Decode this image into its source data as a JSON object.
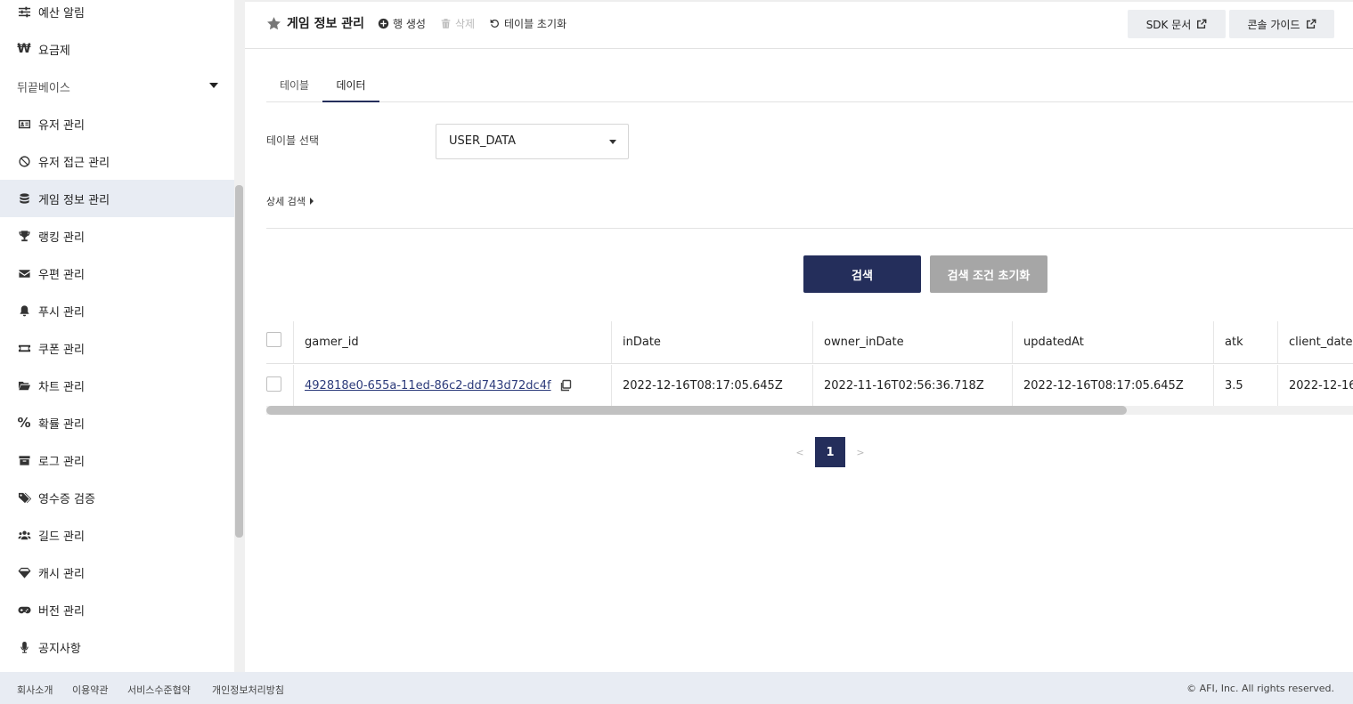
{
  "sidebar": {
    "items": [
      {
        "label": "예산 알림",
        "icon": "sliders-icon"
      },
      {
        "label": "요금제",
        "icon": "won-icon"
      },
      {
        "label": "뒤끝베이스",
        "icon": "",
        "section": true
      },
      {
        "label": "유저 관리",
        "icon": "id-card-icon"
      },
      {
        "label": "유저 접근 관리",
        "icon": "ban-icon"
      },
      {
        "label": "게임 정보 관리",
        "icon": "database-icon",
        "active": true
      },
      {
        "label": "랭킹 관리",
        "icon": "trophy-icon"
      },
      {
        "label": "우편 관리",
        "icon": "envelope-icon"
      },
      {
        "label": "푸시 관리",
        "icon": "bell-icon"
      },
      {
        "label": "쿠폰 관리",
        "icon": "ticket-icon"
      },
      {
        "label": "차트 관리",
        "icon": "folder-open-icon"
      },
      {
        "label": "확률 관리",
        "icon": "percent-icon"
      },
      {
        "label": "로그 관리",
        "icon": "archive-icon"
      },
      {
        "label": "영수증 검증",
        "icon": "tags-icon"
      },
      {
        "label": "길드 관리",
        "icon": "users-icon"
      },
      {
        "label": "캐시 관리",
        "icon": "gem-icon"
      },
      {
        "label": "버전 관리",
        "icon": "gamepad-icon"
      },
      {
        "label": "공지사항",
        "icon": "microphone-icon"
      }
    ]
  },
  "header": {
    "title": "게임 정보 관리",
    "actions": {
      "create_row": "행 생성",
      "delete": "삭제",
      "reset_table": "테이블 초기화"
    },
    "sdk_doc": "SDK 문서",
    "console_guide": "콘솔 가이드"
  },
  "tabs": [
    {
      "label": "테이블",
      "active": false
    },
    {
      "label": "데이터",
      "active": true
    }
  ],
  "form": {
    "table_select_label": "테이블 선택",
    "table_selected": "USER_DATA",
    "advanced_search": "상세 검색",
    "search_button": "검색",
    "reset_button": "검색 조건 초기화"
  },
  "table": {
    "columns": [
      "gamer_id",
      "inDate",
      "owner_inDate",
      "updatedAt",
      "atk",
      "client_date"
    ],
    "rows": [
      {
        "gamer_id": "492818e0-655a-11ed-86c2-dd743d72dc4f",
        "inDate": "2022-12-16T08:17:05.645Z",
        "owner_inDate": "2022-11-16T02:56:36.718Z",
        "updatedAt": "2022-12-16T08:17:05.645Z",
        "atk": "3.5",
        "client_date": "2022-12-16"
      }
    ]
  },
  "pagination": {
    "prev": "<",
    "current": "1",
    "next": ">"
  },
  "footer": {
    "links": [
      "회사소개",
      "이용약관",
      "서비스수준협약",
      "개인정보처리방침"
    ],
    "copyright": "© AFI, Inc. All rights reserved."
  },
  "colors": {
    "accent": "#242e5b",
    "active_bg": "#e8ecf3",
    "disabled_btn": "#a6a6a6"
  }
}
